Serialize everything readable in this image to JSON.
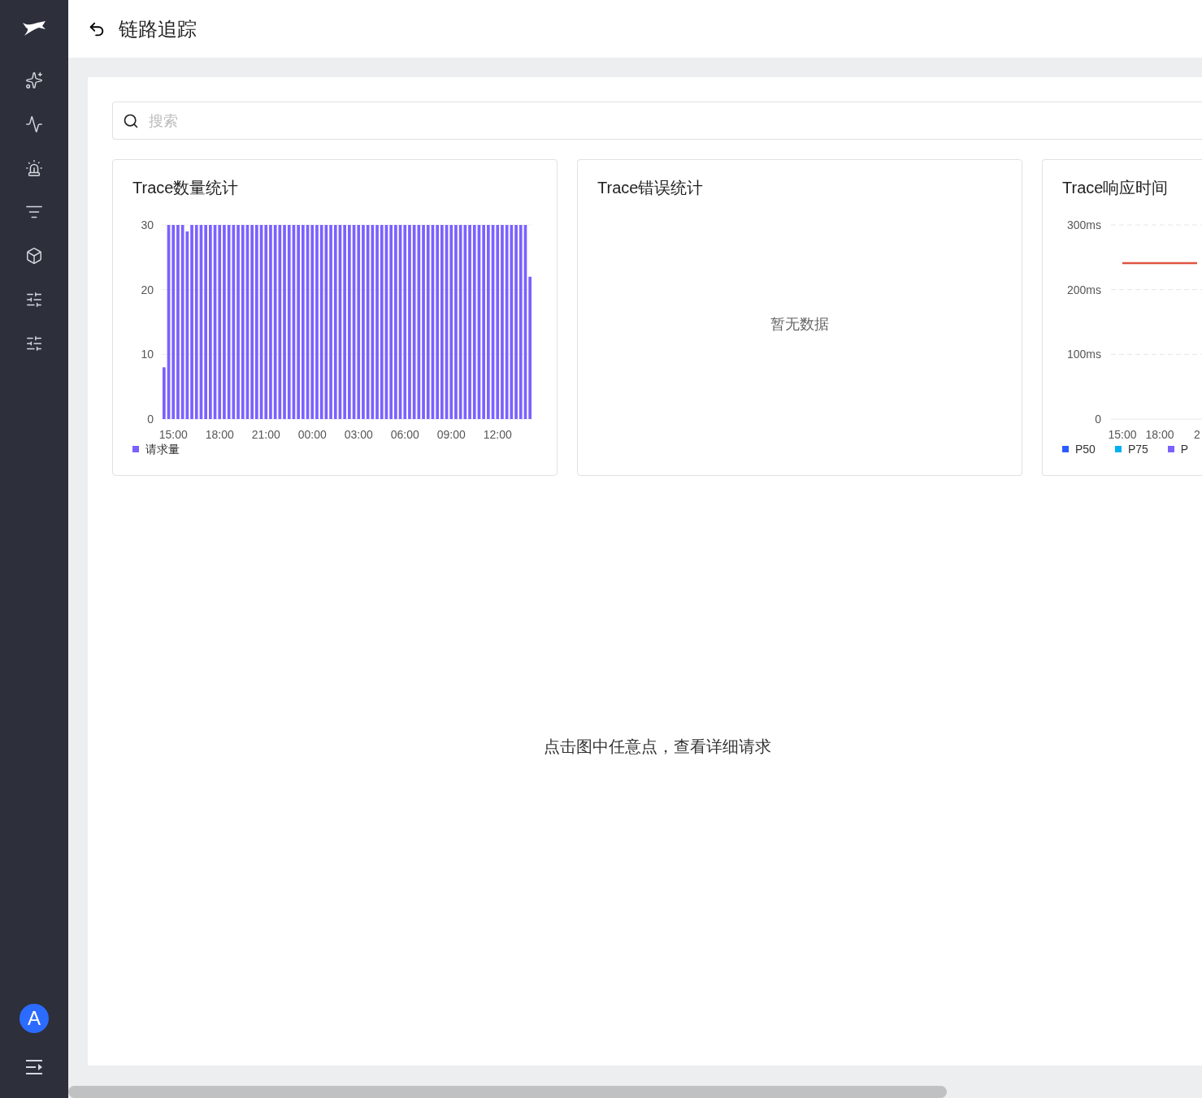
{
  "header": {
    "title": "链路追踪"
  },
  "search": {
    "placeholder": "搜索"
  },
  "cards": [
    {
      "kind": "chart",
      "title": "Trace数量统计",
      "chart_data": {
        "type": "bar",
        "ylim": [
          0,
          30
        ],
        "yticks": [
          0,
          10,
          20,
          30
        ],
        "categories": [
          null,
          null,
          "15:00",
          null,
          null,
          null,
          null,
          null,
          null,
          null,
          null,
          null,
          "18:00",
          null,
          null,
          null,
          null,
          null,
          null,
          null,
          null,
          null,
          "21:00",
          null,
          null,
          null,
          null,
          null,
          null,
          null,
          null,
          null,
          "00:00",
          null,
          null,
          null,
          null,
          null,
          null,
          null,
          null,
          null,
          "03:00",
          null,
          null,
          null,
          null,
          null,
          null,
          null,
          null,
          null,
          "06:00",
          null,
          null,
          null,
          null,
          null,
          null,
          null,
          null,
          null,
          "09:00",
          null,
          null,
          null,
          null,
          null,
          null,
          null,
          null,
          null,
          "12:00",
          null,
          null,
          null,
          null,
          null,
          null,
          null
        ],
        "series": [
          {
            "name": "请求量",
            "color": "#7b61ff",
            "values": [
              8,
              30,
              30,
              30,
              30,
              29,
              30,
              30,
              30,
              30,
              30,
              30,
              30,
              30,
              30,
              30,
              30,
              30,
              30,
              30,
              30,
              30,
              30,
              30,
              30,
              30,
              30,
              30,
              30,
              30,
              30,
              30,
              30,
              30,
              30,
              30,
              30,
              30,
              30,
              30,
              30,
              30,
              30,
              30,
              30,
              30,
              30,
              30,
              30,
              30,
              30,
              30,
              30,
              30,
              30,
              30,
              30,
              30,
              30,
              30,
              30,
              30,
              30,
              30,
              30,
              30,
              30,
              30,
              30,
              30,
              30,
              30,
              30,
              30,
              30,
              30,
              30,
              30,
              30,
              22
            ]
          }
        ]
      }
    },
    {
      "kind": "empty",
      "title": "Trace错误统计",
      "empty_text": "暂无数据"
    },
    {
      "kind": "chart",
      "title": "Trace响应时间",
      "legend": [
        {
          "name": "P50",
          "color": "#2b5cff"
        },
        {
          "name": "P75",
          "color": "#00b0f0"
        },
        {
          "name": "P",
          "color": "#7b61ff"
        }
      ],
      "chart_data": {
        "type": "line",
        "ylim": [
          0,
          300
        ],
        "yticks": [
          {
            "value": 0,
            "label": "0"
          },
          {
            "value": 100,
            "label": "100ms"
          },
          {
            "value": 200,
            "label": "200ms"
          },
          {
            "value": 300,
            "label": "300ms"
          }
        ],
        "categories": [
          "15:00",
          "18:00",
          "2"
        ],
        "series": [
          {
            "color": "#e0533f",
            "values": [
              241,
              241,
              241
            ]
          }
        ]
      }
    }
  ],
  "hint": "点击图中任意点，查看详细请求",
  "user": {
    "initial": "A"
  }
}
